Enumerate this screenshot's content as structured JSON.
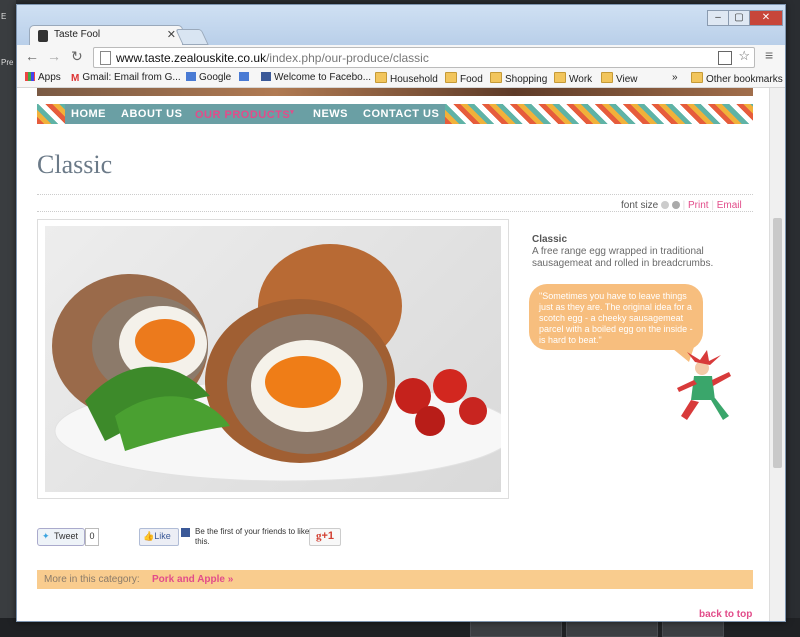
{
  "desktop": {
    "left_labels": [
      "E",
      "Pre"
    ]
  },
  "browser": {
    "tab_title": "Taste Fool",
    "url_host": "www.taste.zealouskite.co.uk",
    "url_path": "/index.php/our-produce/classic",
    "bookmarks": [
      "Apps",
      "Gmail: Email from G...",
      "Google",
      "Welcome to Facebo...",
      "Household",
      "Food",
      "Shopping",
      "Work",
      "View"
    ],
    "overflow": "»",
    "other_bookmarks": "Other bookmarks"
  },
  "site": {
    "menu": [
      "HOME",
      "ABOUT US",
      "OUR PRODUCTS",
      "NEWS",
      "CONTACT US"
    ],
    "page_title": "Classic",
    "font_size_label": "font size",
    "print_label": "Print",
    "email_label": "Email",
    "product": {
      "name": "Classic",
      "description": "A free range egg wrapped in traditional sausagemeat and rolled in breadcrumbs.",
      "quote": "\"Sometimes you have to leave things just as they are. The original idea for a scotch egg - a cheeky sausagemeat parcel with a boiled egg on the inside - is hard to beat.\""
    },
    "social": {
      "tweet_label": "Tweet",
      "tweet_count": "0",
      "like_label": "Like",
      "like_text": "Be the first of your friends to like this.",
      "gplus_label": "+1"
    },
    "category": {
      "label": "More in this category:",
      "link": "Pork and Apple »"
    },
    "back_to_top": "back to top"
  },
  "colors": {
    "nav_teal": "#6a9fa4",
    "accent_pink": "#e24c8a",
    "bubble_orange": "#f7be7e",
    "category_bar": "#f9cc8e"
  }
}
